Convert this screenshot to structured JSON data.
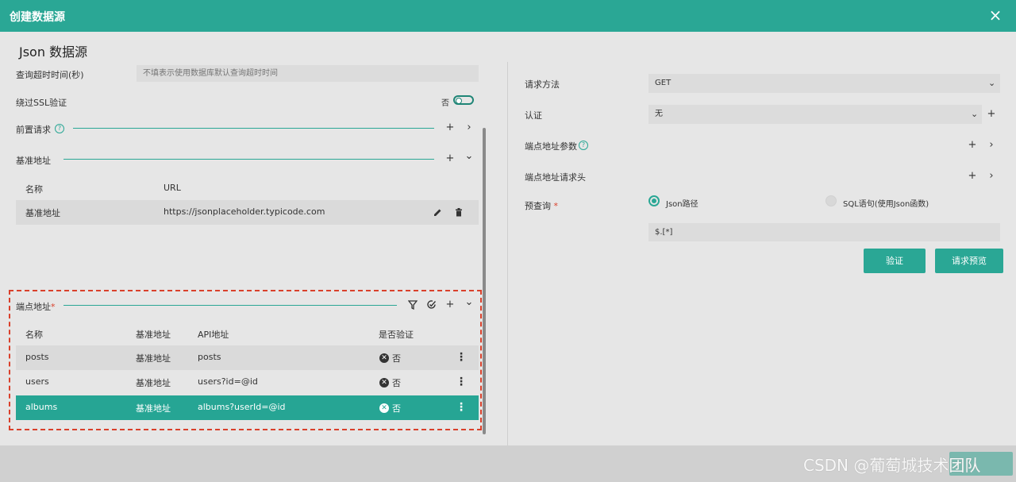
{
  "window": {
    "title": "创建数据源",
    "close_icon": "×"
  },
  "dialog_title": "Json 数据源",
  "left": {
    "timeout": {
      "label": "查询超时时间(秒)",
      "placeholder": "不填表示使用数据库默认查询超时时间"
    },
    "ssl": {
      "label": "绕过SSL验证",
      "state_text": "否",
      "enabled": false
    },
    "pre_request": {
      "label": "前置请求",
      "help": "?",
      "add": "+",
      "expand": "›"
    },
    "base_url": {
      "label": "基准地址",
      "add": "+",
      "collapse": "⌄",
      "columns": [
        "名称",
        "URL"
      ],
      "rows": [
        {
          "name": "基准地址",
          "url": "https://jsonplaceholder.typicode.com"
        }
      ]
    },
    "endpoints": {
      "label": "端点地址",
      "required": "*",
      "add": "+",
      "collapse": "⌄",
      "columns": [
        "名称",
        "基准地址",
        "API地址",
        "是否验证"
      ],
      "rows": [
        {
          "name": "posts",
          "base": "基准地址",
          "api": "posts",
          "verify": "否"
        },
        {
          "name": "users",
          "base": "基准地址",
          "api": "users?id=@id",
          "verify": "否"
        },
        {
          "name": "albums",
          "base": "基准地址",
          "api": "albums?userId=@id",
          "verify": "否"
        }
      ],
      "selected_row": 2
    }
  },
  "right": {
    "method": {
      "label": "请求方法",
      "value": "GET"
    },
    "auth": {
      "label": "认证",
      "value": "无"
    },
    "endpoint_params": {
      "label": "端点地址参数",
      "help": "?"
    },
    "endpoint_headers": {
      "label": "端点地址请求头"
    },
    "prequery": {
      "label": "预查询",
      "required": "*",
      "option_json": "Json路径",
      "option_sql": "SQL语句(使用Json函数)",
      "selected": "json",
      "value": "$.[*]"
    },
    "buttons": {
      "verify": "验证",
      "preview": "请求预览"
    }
  },
  "watermark": "CSDN @葡萄城技术团队",
  "colors": {
    "accent": "#2aa795",
    "dash": "#d9402b"
  }
}
